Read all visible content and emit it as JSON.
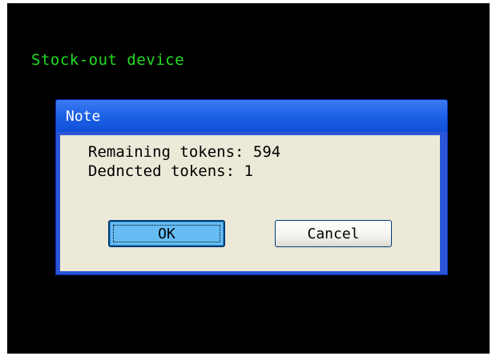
{
  "screen": {
    "title": "Stock-out device"
  },
  "dialog": {
    "title": "Note",
    "messages": {
      "line1": "Remaining tokens: 594",
      "line2": "Dednсted tokens: 1"
    },
    "buttons": {
      "ok_label": "OK",
      "cancel_label": "Cancel"
    }
  },
  "colors": {
    "screen_bg": "#000000",
    "title_text": "#22dd22",
    "dialog_titlebar": "#1f63e6",
    "dialog_body": "#ece9d8",
    "ok_button": "#66bdf5"
  }
}
